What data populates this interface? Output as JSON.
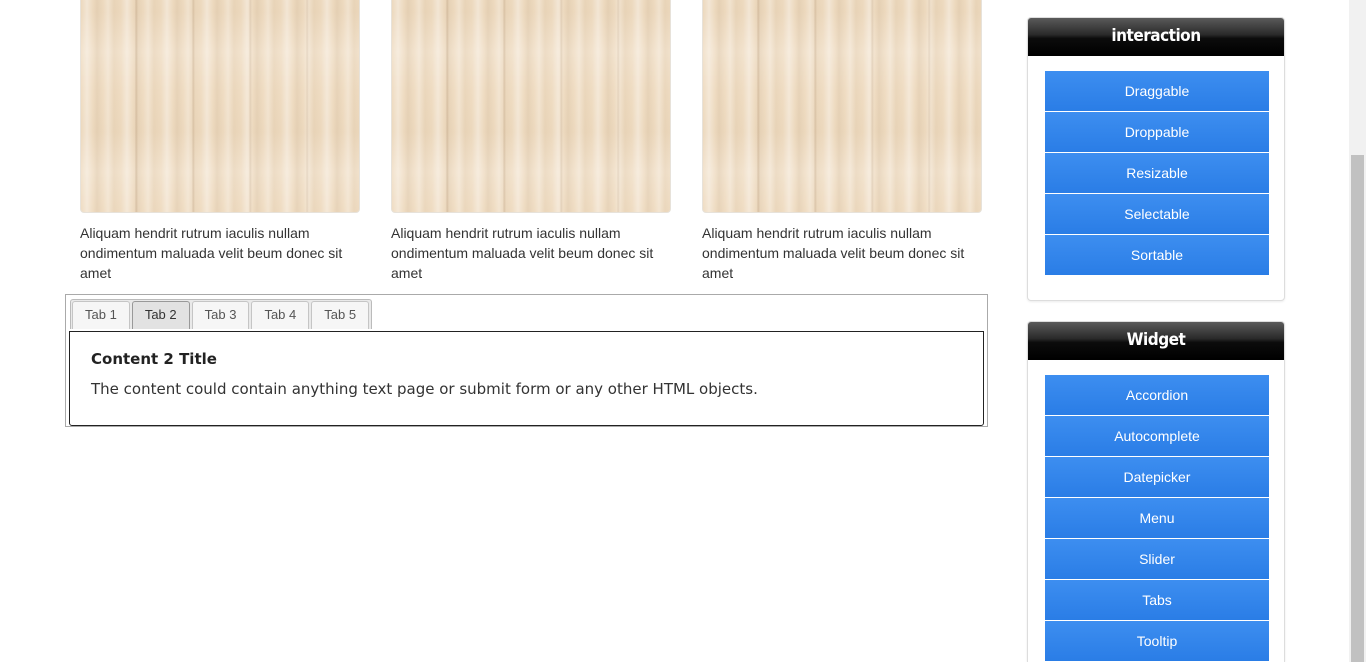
{
  "gallery": [
    {
      "caption": "Aliquam hendrit rutrum iaculis nullam ondimentum maluada velit beum donec sit amet"
    },
    {
      "caption": "Aliquam hendrit rutrum iaculis nullam ondimentum maluada velit beum donec sit amet"
    },
    {
      "caption": "Aliquam hendrit rutrum iaculis nullam ondimentum maluada velit beum donec sit amet"
    }
  ],
  "tabs": {
    "items": [
      {
        "label": "Tab 1"
      },
      {
        "label": "Tab 2"
      },
      {
        "label": "Tab 3"
      },
      {
        "label": "Tab 4"
      },
      {
        "label": "Tab 5"
      }
    ],
    "active": "Tab 2",
    "panel": {
      "title": "Content 2 Title",
      "text": "The content could contain anything text page or submit form or any other HTML objects."
    }
  },
  "sidebar": {
    "interaction": {
      "title": "interaction",
      "items": [
        {
          "label": "Draggable"
        },
        {
          "label": "Droppable"
        },
        {
          "label": "Resizable"
        },
        {
          "label": "Selectable"
        },
        {
          "label": "Sortable"
        }
      ]
    },
    "widget": {
      "title": "Widget",
      "items": [
        {
          "label": "Accordion"
        },
        {
          "label": "Autocomplete"
        },
        {
          "label": "Datepicker"
        },
        {
          "label": "Menu"
        },
        {
          "label": "Slider"
        },
        {
          "label": "Tabs"
        },
        {
          "label": "Tooltip"
        }
      ]
    }
  },
  "colors": {
    "link_button": "#2f84ec",
    "header_dark": "#0c0c0c",
    "wood": "#efdcc2"
  }
}
